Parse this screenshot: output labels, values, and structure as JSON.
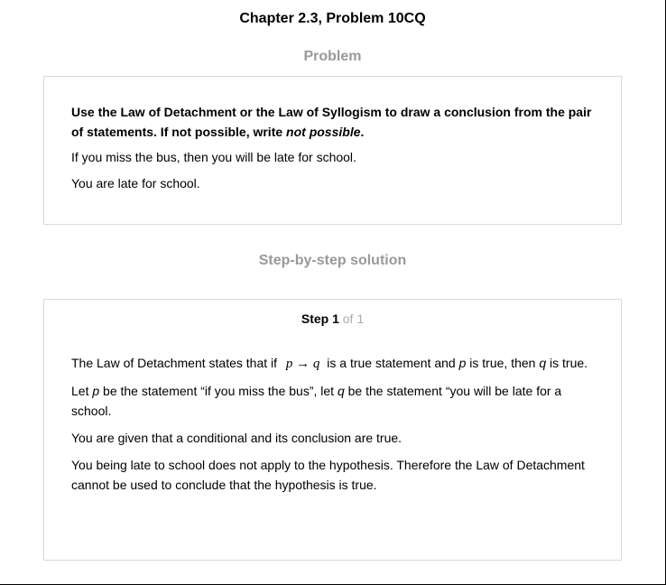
{
  "header": {
    "title": "Chapter 2.3, Problem 10CQ"
  },
  "problem": {
    "heading": "Problem",
    "instruction_main": "Use the Law of Detachment or the Law of Syllogism to draw a conclusion from the pair of statements. If not possible, write ",
    "instruction_emph": "not possible",
    "instruction_end": ".",
    "statements": [
      "If you miss the bus, then you will be late for school.",
      "You are late for school."
    ]
  },
  "solution": {
    "heading": "Step-by-step solution",
    "step_label": "Step 1",
    "step_of": "of 1",
    "para1_a": "The Law of Detachment states that if ",
    "para1_math": "p → q",
    "para1_b": " is a true statement and ",
    "para1_p": "p",
    "para1_c": " is true, then ",
    "para1_q": "q",
    "para1_d": " is true.",
    "para2_a": "Let ",
    "para2_p": "p",
    "para2_b": " be the statement “if you miss the bus”, let ",
    "para2_q": "q",
    "para2_c": " be the statement “you will be late for a school.",
    "para3": "You are given that a conditional and its conclusion are true.",
    "para4": "You being late to school does not apply to the hypothesis. Therefore the Law of Detachment cannot be used to conclude that the hypothesis is true."
  }
}
